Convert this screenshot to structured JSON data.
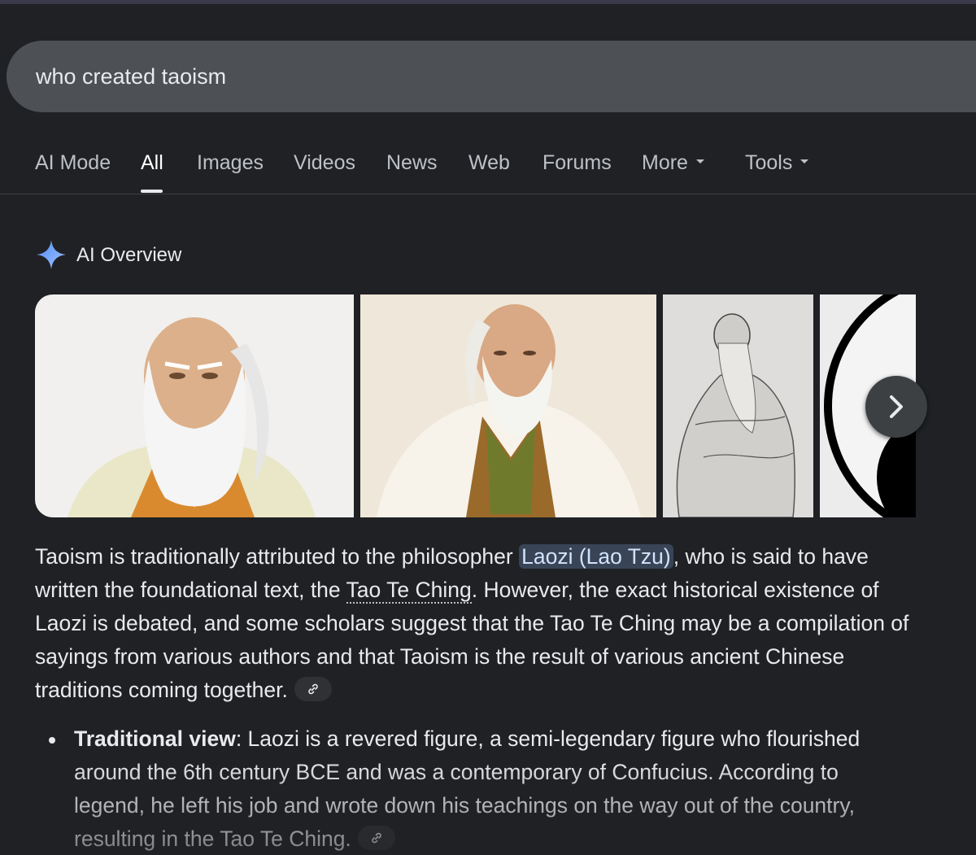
{
  "search": {
    "query": "who created taoism"
  },
  "tabs": [
    {
      "label": "AI Mode"
    },
    {
      "label": "All",
      "active": true
    },
    {
      "label": "Images"
    },
    {
      "label": "Videos"
    },
    {
      "label": "News"
    },
    {
      "label": "Web"
    },
    {
      "label": "Forums"
    },
    {
      "label": "More"
    },
    {
      "label": "Tools"
    }
  ],
  "ai_overview": {
    "title": "AI Overview",
    "icon": "sparkle-icon",
    "images": [
      {
        "subject": "painted portrait of Laozi with white beard and orange robe",
        "icon": "laozi-portrait-image"
      },
      {
        "subject": "illustrated Laozi in white robe with olive collar",
        "icon": "laozi-illustration-image"
      },
      {
        "subject": "ink sketch of standing Laozi",
        "icon": "laozi-sketch-image"
      },
      {
        "subject": "yin-yang symbol (partial)",
        "icon": "yin-yang-image"
      }
    ],
    "paragraph": {
      "part1": "Taoism is traditionally attributed to the philosopher ",
      "highlight": "Laozi (Lao Tzu)",
      "part2": ", who is said to have written the foundational text, the ",
      "dotted_link": "Tao Te Ching",
      "part3": ". However, the exact historical existence of Laozi is debated, and some scholars suggest that the Tao Te Ching may be a compilation of sayings from various authors and that Taoism is the result of various ancient Chinese traditions coming together."
    },
    "bullets": [
      {
        "bold": "Traditional view",
        "text": ": Laozi is a revered figure, a semi-legendary figure who flourished around the 6th century BCE and was a contemporary of Confucius. According to legend, he left his job and wrote down his teachings on the way out of the country, resulting in the Tao Te Ching."
      }
    ]
  },
  "colors": {
    "background": "#202124",
    "search_bar": "#4d5156",
    "highlight_bg": "#394457",
    "sparkle_blue": "#8ab4f8"
  }
}
